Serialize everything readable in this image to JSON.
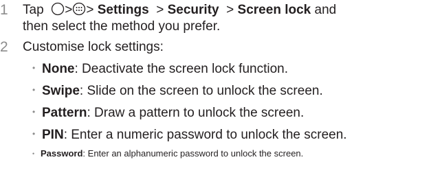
{
  "steps": [
    {
      "number": "1",
      "prefix": "Tap",
      "sep1": ">",
      "sep2": ">",
      "settings": "Settings",
      "sep3": ">",
      "security": "Security",
      "sep4": ">",
      "screen_lock": "Screen lock",
      "suffix": "and",
      "line2": "then select the method you prefer.",
      "icons": [
        "home-circle-icon",
        "apps-drawer-icon"
      ]
    },
    {
      "number": "2",
      "text": "Customise lock settings:"
    }
  ],
  "options": [
    {
      "term": "None",
      "desc": ": Deactivate the screen lock function."
    },
    {
      "term": "Swipe",
      "desc": ": Slide on the screen to unlock the screen."
    },
    {
      "term": "Pattern",
      "desc": ": Draw a pattern to unlock the screen."
    },
    {
      "term": "PIN",
      "desc": ": Enter a numeric password to unlock the screen."
    },
    {
      "term": "Password",
      "desc": ": Enter an alphanumeric password to unlock the screen."
    }
  ],
  "bullet_glyph": "•"
}
